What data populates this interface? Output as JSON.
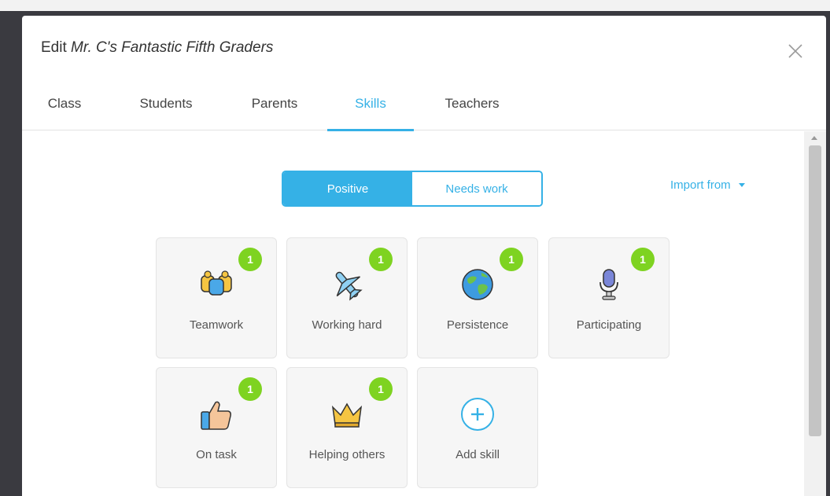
{
  "modal": {
    "title_prefix": "Edit",
    "class_name": "Mr. C's Fantastic Fifth Graders"
  },
  "tabs": [
    {
      "label": "Class"
    },
    {
      "label": "Students"
    },
    {
      "label": "Parents"
    },
    {
      "label": "Skills",
      "active": true
    },
    {
      "label": "Teachers"
    }
  ],
  "skills_toggle": {
    "positive_label": "Positive",
    "needs_work_label": "Needs work",
    "selected": "Positive"
  },
  "import_from_label": "Import from",
  "skills": [
    {
      "label": "Teamwork",
      "points": "1",
      "icon": "teamwork-icon"
    },
    {
      "label": "Working hard",
      "points": "1",
      "icon": "airplane-icon"
    },
    {
      "label": "Persistence",
      "points": "1",
      "icon": "globe-icon"
    },
    {
      "label": "Participating",
      "points": "1",
      "icon": "microphone-icon"
    },
    {
      "label": "On task",
      "points": "1",
      "icon": "thumbs-up-icon"
    },
    {
      "label": "Helping others",
      "points": "1",
      "icon": "crown-icon"
    }
  ],
  "add_skill_label": "Add skill",
  "colors": {
    "accent": "#35b1e6",
    "badge": "#7ed321"
  }
}
